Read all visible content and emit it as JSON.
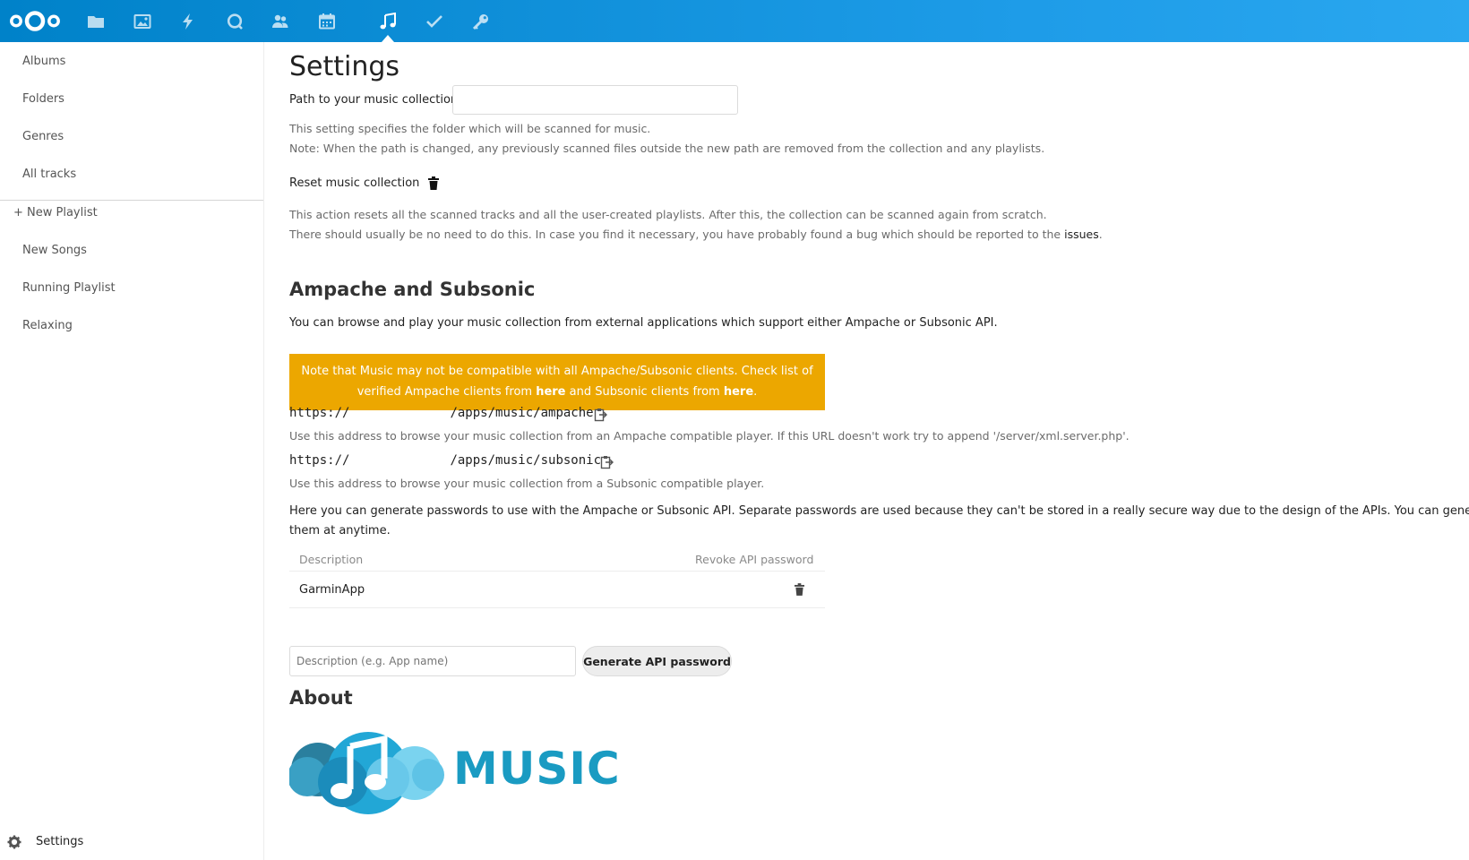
{
  "header": {
    "logo_name": "nextcloud-logo",
    "apps": [
      {
        "name": "files-icon"
      },
      {
        "name": "photos-icon"
      },
      {
        "name": "activity-icon"
      },
      {
        "name": "talk-icon"
      },
      {
        "name": "contacts-icon"
      },
      {
        "name": "calendar-icon"
      },
      {
        "name": "music-icon",
        "active": true
      },
      {
        "name": "tasks-icon"
      },
      {
        "name": "passwords-icon"
      }
    ],
    "colors": {
      "start": "#0082c9",
      "end": "#2aa7ef"
    }
  },
  "sidebar": {
    "items": [
      {
        "label": "Albums"
      },
      {
        "label": "Folders"
      },
      {
        "label": "Genres"
      },
      {
        "label": "All tracks"
      }
    ],
    "new_playlist": "+ New Playlist",
    "playlists": [
      {
        "label": "New Songs"
      },
      {
        "label": "Running Playlist"
      },
      {
        "label": "Relaxing"
      }
    ],
    "settings_label": "Settings"
  },
  "settings": {
    "title": "Settings",
    "path_label": "Path to your music collection:",
    "path_value": "",
    "path_help_1": "This setting specifies the folder which will be scanned for music.",
    "path_help_2": "Note: When the path is changed, any previously scanned files outside the new path are removed from the collection and any playlists.",
    "reset_label": "Reset music collection",
    "reset_help_1": "This action resets all the scanned tracks and all the user-created playlists. After this, the collection can be scanned again from scratch.",
    "reset_help_2": "There should usually be no need to do this. In case you find it necessary, you have probably found a bug which should be reported to the",
    "reset_help_link": "issues",
    "reset_help_end": "."
  },
  "ampache": {
    "heading": "Ampache and Subsonic",
    "intro": "You can browse and play your music collection from external applications which support either Ampache or Subsonic API.",
    "warning_1": "Note that Music may not be compatible with all Ampache/Subsonic clients. Check list of",
    "warning_2a": "verified Ampache clients from ",
    "warning_link1": "here",
    "warning_2b": " and Subsonic clients from ",
    "warning_link2": "here",
    "warning_2c": ".",
    "warning_color": "#eca700",
    "ampache_url_prefix": "https://",
    "ampache_url_suffix": "/apps/music/ampache",
    "ampache_help": "Use this address to browse your music collection from an Ampache compatible player. If this URL doesn't work try to append '/server/xml.server.php'.",
    "subsonic_url_prefix": "https://",
    "subsonic_url_suffix": "/apps/music/subsonic",
    "subsonic_help": "Use this address to browse your music collection from a Subsonic compatible player.",
    "passwords_help_1": "Here you can generate passwords to use with the Ampache or Subsonic API. Separate passwords are used because they can't be stored in a really secure way due to the design of the APIs. You can generate as many",
    "passwords_help_2": "them at anytime.",
    "table_headers": [
      "Description",
      "Revoke API password"
    ],
    "table_rows": [
      {
        "description": "GarminApp"
      }
    ],
    "desc_placeholder": "Description (e.g. App name)",
    "generate_label": "Generate API password"
  },
  "about": {
    "heading": "About",
    "logo_text": "MUSIC",
    "logo_color": "#1a9bc2"
  }
}
